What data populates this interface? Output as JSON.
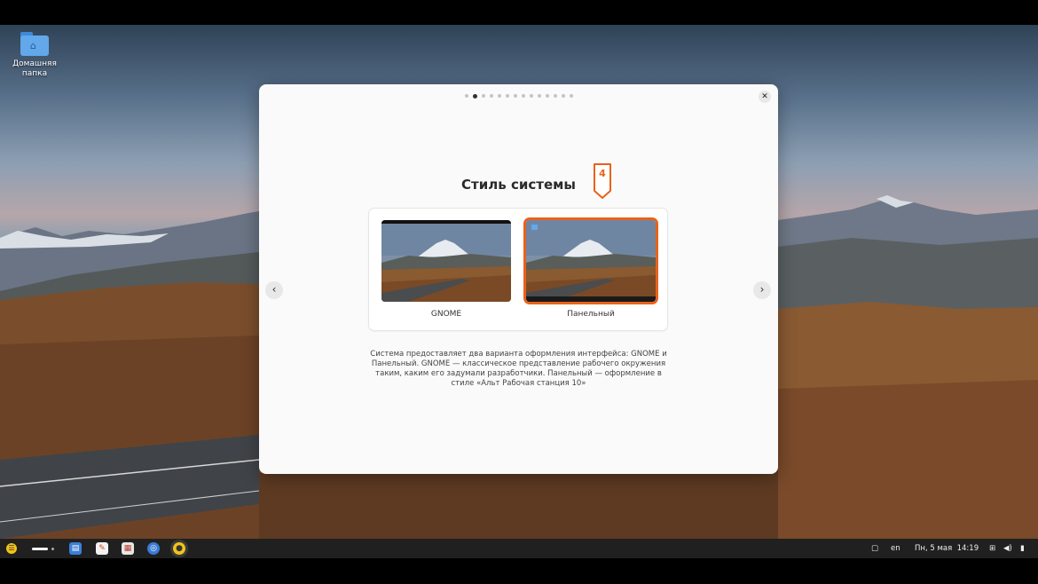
{
  "desktop": {
    "home_folder_label": "Домашняя папка",
    "home_folder_icon": "home-folder-icon"
  },
  "dialog": {
    "title": "Стиль системы",
    "close_label": "✕",
    "prev_label": "‹",
    "next_label": "›",
    "page_dots_total": 14,
    "page_dots_active": 2,
    "step_marker": "4",
    "options": [
      {
        "label": "GNOME",
        "selected": false
      },
      {
        "label": "Панельный",
        "selected": true
      }
    ],
    "description": "Система предоставляет два варианта оформления интерфейса: GNOME и Панельный. GNOME — классическое представление рабочего окружения таким, каким его задумали разработчики. Панельный — оформление в стиле «Альт Рабочая станция 10»",
    "accent_color": "#e8621c"
  },
  "taskbar": {
    "apps": [
      "files-icon",
      "text-editor-icon",
      "software-store-icon",
      "chromium-icon",
      "welcome-app-icon"
    ],
    "language": "en",
    "clock": "Пн, 5 мая  14:19",
    "tray_icons": [
      "clipboard-icon",
      "network-icon",
      "volume-icon",
      "battery-icon"
    ]
  }
}
